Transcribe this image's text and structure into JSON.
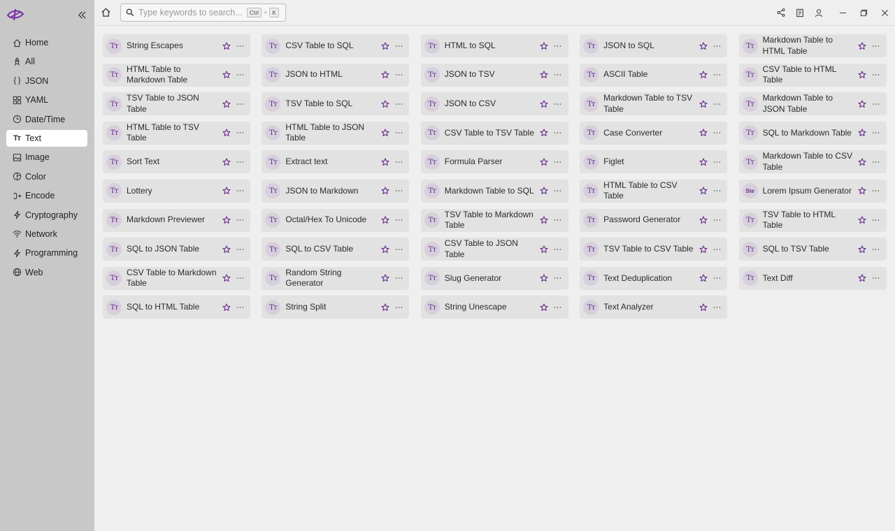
{
  "sidebar": {
    "items": [
      {
        "label": "Home",
        "icon": "home-icon"
      },
      {
        "label": "All",
        "icon": "rocket-icon"
      },
      {
        "label": "JSON",
        "icon": "braces-icon"
      },
      {
        "label": "YAML",
        "icon": "grid-icon"
      },
      {
        "label": "Date/Time",
        "icon": "clock-icon"
      },
      {
        "label": "Text",
        "icon": "text-icon",
        "active": true
      },
      {
        "label": "Image",
        "icon": "image-icon"
      },
      {
        "label": "Color",
        "icon": "palette-icon"
      },
      {
        "label": "Encode",
        "icon": "encode-icon"
      },
      {
        "label": "Cryptography",
        "icon": "bolt-icon"
      },
      {
        "label": "Network",
        "icon": "wifi-icon"
      },
      {
        "label": "Programming",
        "icon": "bolt-icon"
      },
      {
        "label": "Web",
        "icon": "globe-icon"
      }
    ]
  },
  "search": {
    "placeholder": "Type keywords to search...",
    "shortcut_mod": "Ctrl",
    "shortcut_plus": "+",
    "shortcut_key": "K"
  },
  "accent_color": "#6a2d8c",
  "tools": [
    {
      "label": "String Escapes"
    },
    {
      "label": "CSV Table to SQL"
    },
    {
      "label": "HTML to SQL"
    },
    {
      "label": "JSON to SQL"
    },
    {
      "label": "Markdown Table to HTML Table"
    },
    {
      "label": "HTML Table to Markdown Table"
    },
    {
      "label": "JSON to HTML"
    },
    {
      "label": "JSON to TSV"
    },
    {
      "label": "ASCII Table"
    },
    {
      "label": "CSV Table to HTML Table"
    },
    {
      "label": "TSV Table to JSON Table"
    },
    {
      "label": "TSV Table to SQL"
    },
    {
      "label": "JSON to CSV"
    },
    {
      "label": "Markdown Table to TSV Table"
    },
    {
      "label": "Markdown Table to JSON Table"
    },
    {
      "label": "HTML Table to TSV Table"
    },
    {
      "label": "HTML Table to JSON Table"
    },
    {
      "label": "CSV Table to TSV Table"
    },
    {
      "label": "Case Converter"
    },
    {
      "label": "SQL to Markdown Table"
    },
    {
      "label": "Sort Text"
    },
    {
      "label": "Extract text"
    },
    {
      "label": "Formula Parser"
    },
    {
      "label": "Figlet"
    },
    {
      "label": "Markdown Table to CSV Table"
    },
    {
      "label": "Lottery"
    },
    {
      "label": "JSON to Markdown"
    },
    {
      "label": "Markdown Table to SQL"
    },
    {
      "label": "HTML Table to CSV Table"
    },
    {
      "label": "Lorem Ipsum Generator",
      "icon_text": "Ste"
    },
    {
      "label": "Markdown Previewer"
    },
    {
      "label": "Octal/Hex To Unicode"
    },
    {
      "label": "TSV Table to Markdown Table"
    },
    {
      "label": "Password Generator"
    },
    {
      "label": "TSV Table to HTML Table"
    },
    {
      "label": "SQL to JSON Table"
    },
    {
      "label": "SQL to CSV Table"
    },
    {
      "label": "CSV Table to JSON Table"
    },
    {
      "label": "TSV Table to CSV Table"
    },
    {
      "label": "SQL to TSV Table"
    },
    {
      "label": "CSV Table to Markdown Table"
    },
    {
      "label": "Random String Generator"
    },
    {
      "label": "Slug Generator"
    },
    {
      "label": "Text Deduplication"
    },
    {
      "label": "Text Diff"
    },
    {
      "label": "SQL to HTML Table"
    },
    {
      "label": "String Split"
    },
    {
      "label": "String Unescape"
    },
    {
      "label": "Text Analyzer"
    }
  ],
  "default_icon_text": "Tт"
}
